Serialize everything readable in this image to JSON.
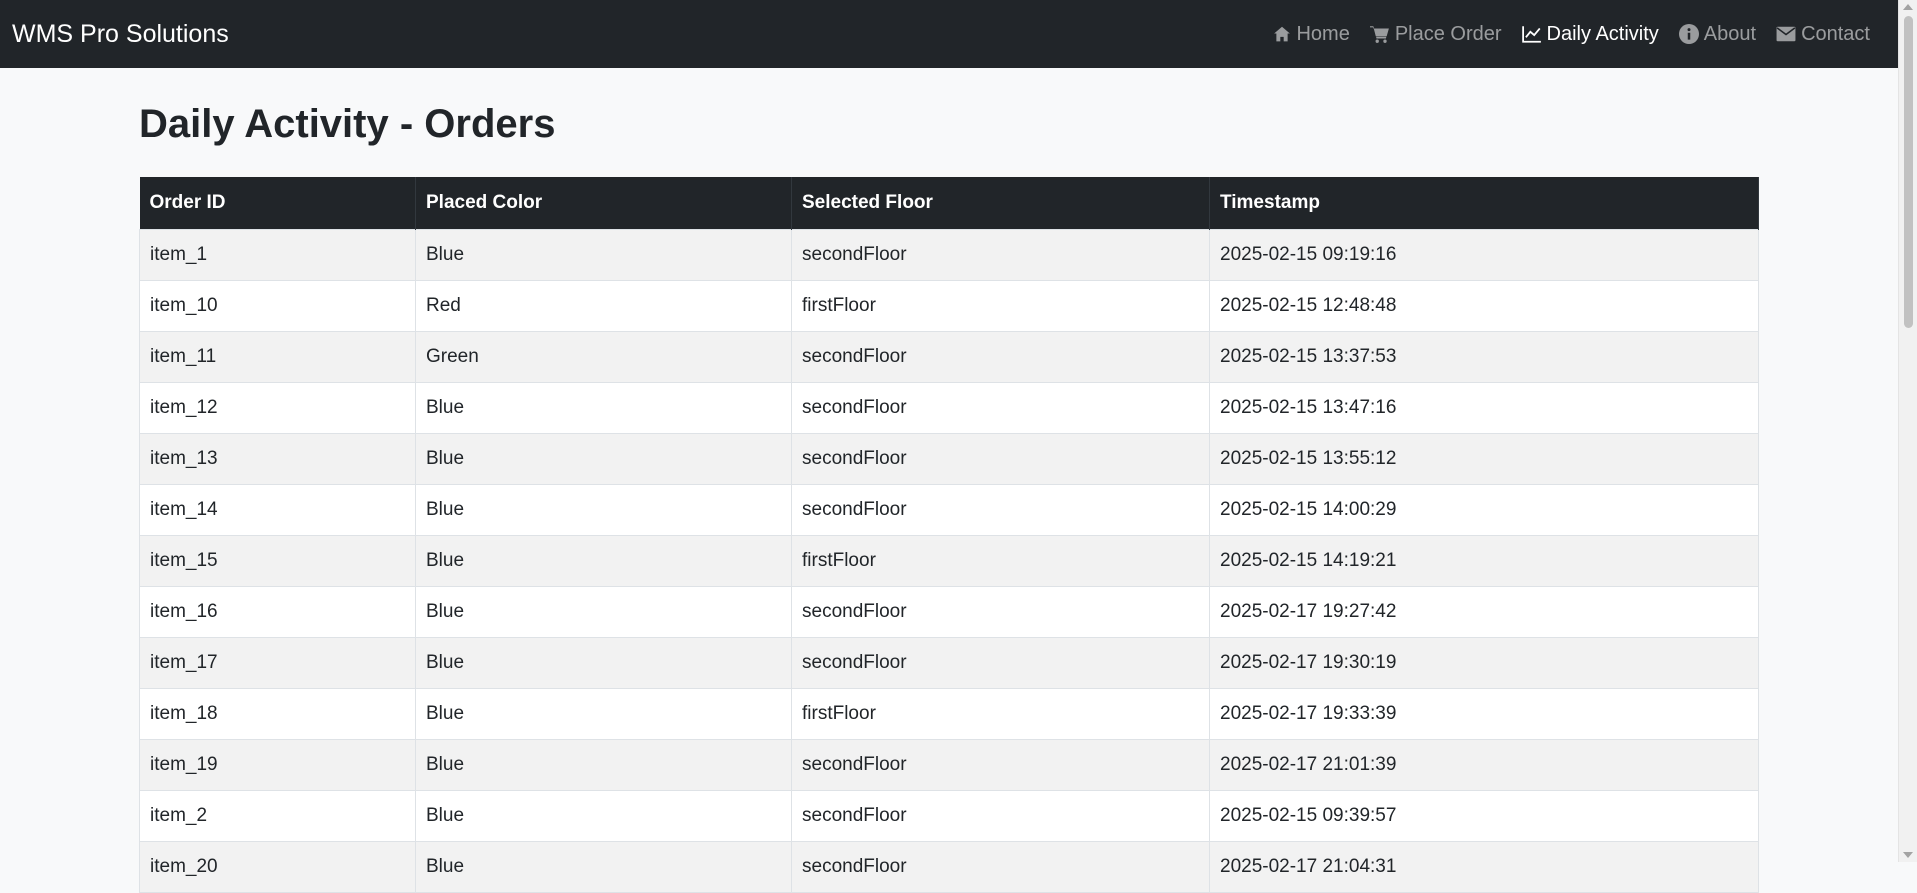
{
  "navbar": {
    "brand": "WMS Pro Solutions",
    "items": [
      {
        "label": "Home",
        "icon": "home-icon",
        "active": false
      },
      {
        "label": "Place Order",
        "icon": "cart-icon",
        "active": false
      },
      {
        "label": "Daily Activity",
        "icon": "chart-line-icon",
        "active": true
      },
      {
        "label": "About",
        "icon": "info-icon",
        "active": false
      },
      {
        "label": "Contact",
        "icon": "envelope-icon",
        "active": false
      }
    ]
  },
  "page": {
    "title": "Daily Activity - Orders"
  },
  "table": {
    "headers": [
      "Order ID",
      "Placed Color",
      "Selected Floor",
      "Timestamp"
    ],
    "rows": [
      [
        "item_1",
        "Blue",
        "secondFloor",
        "2025-02-15 09:19:16"
      ],
      [
        "item_10",
        "Red",
        "firstFloor",
        "2025-02-15 12:48:48"
      ],
      [
        "item_11",
        "Green",
        "secondFloor",
        "2025-02-15 13:37:53"
      ],
      [
        "item_12",
        "Blue",
        "secondFloor",
        "2025-02-15 13:47:16"
      ],
      [
        "item_13",
        "Blue",
        "secondFloor",
        "2025-02-15 13:55:12"
      ],
      [
        "item_14",
        "Blue",
        "secondFloor",
        "2025-02-15 14:00:29"
      ],
      [
        "item_15",
        "Blue",
        "firstFloor",
        "2025-02-15 14:19:21"
      ],
      [
        "item_16",
        "Blue",
        "secondFloor",
        "2025-02-17 19:27:42"
      ],
      [
        "item_17",
        "Blue",
        "secondFloor",
        "2025-02-17 19:30:19"
      ],
      [
        "item_18",
        "Blue",
        "firstFloor",
        "2025-02-17 19:33:39"
      ],
      [
        "item_19",
        "Blue",
        "secondFloor",
        "2025-02-17 21:01:39"
      ],
      [
        "item_2",
        "Blue",
        "secondFloor",
        "2025-02-15 09:39:57"
      ],
      [
        "item_20",
        "Blue",
        "secondFloor",
        "2025-02-17 21:04:31"
      ]
    ]
  },
  "colors": {
    "navbar_bg": "#212529",
    "page_bg": "#f8f9fa",
    "stripe": "#f2f2f2"
  }
}
